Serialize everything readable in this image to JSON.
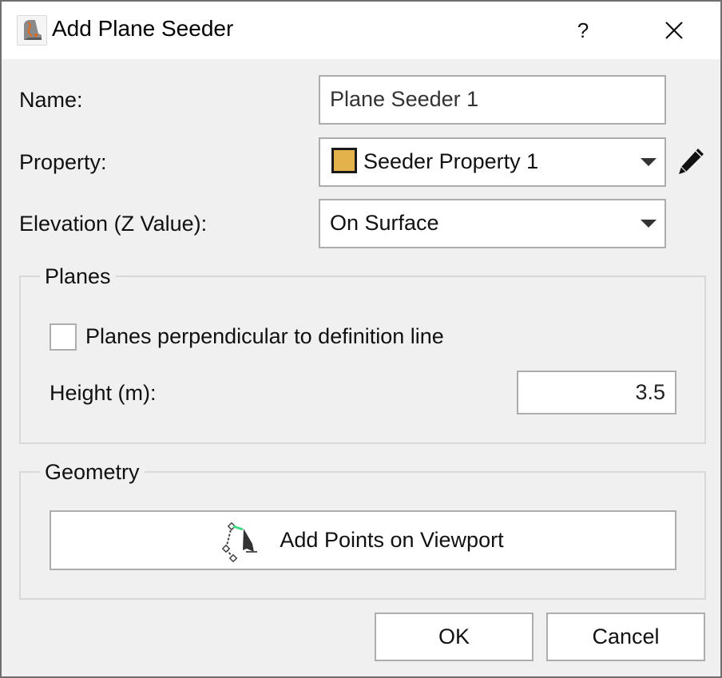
{
  "window": {
    "title": "Add Plane Seeder",
    "app_icon": "plane-seeder-app-icon",
    "help_label": "?",
    "close_icon": "close-icon"
  },
  "form": {
    "name_label": "Name:",
    "name_value": "Plane Seeder 1",
    "property_label": "Property:",
    "property_value": "Seeder Property 1",
    "property_swatch_color": "#e4b24a",
    "property_edit_icon": "pencil-icon",
    "elevation_label": "Elevation (Z Value):",
    "elevation_value": "On Surface"
  },
  "planes_group": {
    "title": "Planes",
    "perpendicular_checkbox_label": "Planes perpendicular to definition line",
    "perpendicular_checked": false,
    "height_label": "Height (m):",
    "height_value": "3.5"
  },
  "geometry_group": {
    "title": "Geometry",
    "add_points_label": "Add Points on Viewport",
    "add_points_icon": "add-points-cursor-icon"
  },
  "footer": {
    "ok_label": "OK",
    "cancel_label": "Cancel"
  }
}
